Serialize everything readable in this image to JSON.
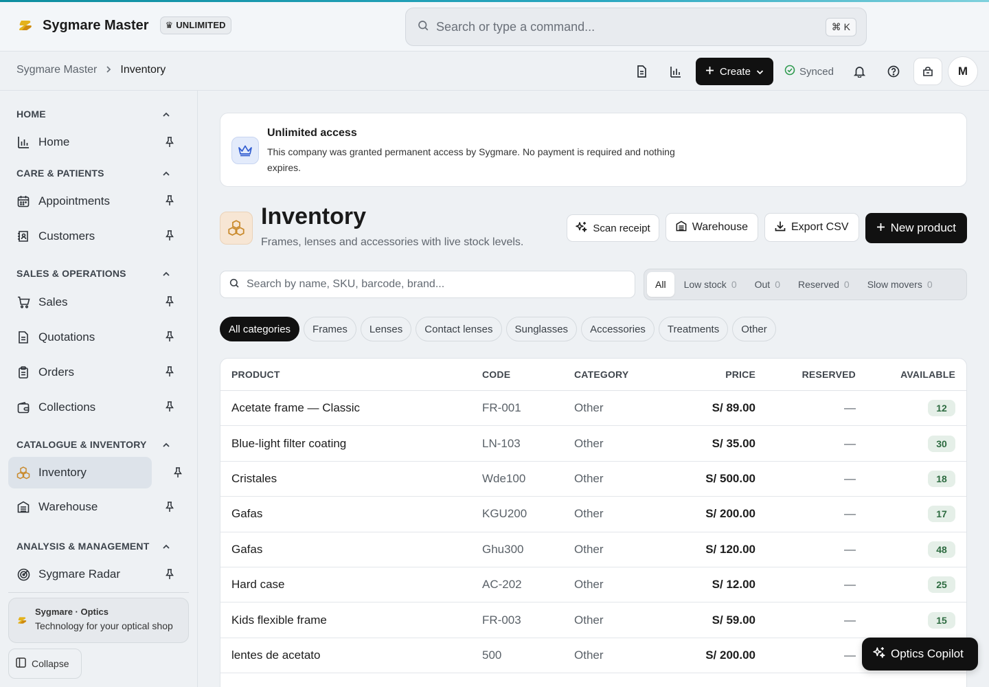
{
  "app": {
    "name": "Sygmare Master",
    "plan_badge": "UNLIMITED",
    "plan_badge_icon": "crown-icon",
    "accent_color": "#0e8ea0"
  },
  "command_search": {
    "placeholder": "Search or type a command...",
    "shortcut": "⌘ K"
  },
  "breadcrumb": {
    "root": "Sygmare Master",
    "current": "Inventory"
  },
  "header_actions": {
    "create_label": "Create",
    "sync_status": "Synced",
    "avatar_initial": "M"
  },
  "sidebar": {
    "sections": [
      {
        "title": "HOME",
        "items": [
          {
            "label": "Home",
            "icon": "bar-chart-icon"
          }
        ]
      },
      {
        "title": "CARE & PATIENTS",
        "items": [
          {
            "label": "Appointments",
            "icon": "calendar-icon"
          },
          {
            "label": "Customers",
            "icon": "contacts-icon"
          }
        ]
      },
      {
        "title": "SALES & OPERATIONS",
        "items": [
          {
            "label": "Sales",
            "icon": "cart-icon"
          },
          {
            "label": "Quotations",
            "icon": "document-icon"
          },
          {
            "label": "Orders",
            "icon": "clipboard-icon"
          },
          {
            "label": "Collections",
            "icon": "wallet-icon"
          }
        ]
      },
      {
        "title": "CATALOGUE & INVENTORY",
        "items": [
          {
            "label": "Inventory",
            "icon": "boxes-icon",
            "active": true
          },
          {
            "label": "Warehouse",
            "icon": "warehouse-icon"
          }
        ]
      },
      {
        "title": "ANALYSIS & MANAGEMENT",
        "items": [
          {
            "label": "Sygmare Radar",
            "icon": "radar-icon"
          }
        ]
      }
    ],
    "promo": {
      "title": "Sygmare · Optics",
      "subtitle": "Technology for your optical shop"
    },
    "collapse_label": "Collapse"
  },
  "notice": {
    "title": "Unlimited access",
    "body": "This company was granted permanent access by Sygmare. No payment is required and nothing expires."
  },
  "page": {
    "title": "Inventory",
    "subtitle": "Frames, lenses and accessories with live stock levels.",
    "actions": {
      "scan_receipt": "Scan receipt",
      "warehouse": "Warehouse",
      "export_csv": "Export CSV",
      "new_product": "New product"
    }
  },
  "inventory_search": {
    "placeholder": "Search by name, SKU, barcode, brand..."
  },
  "stock_filters": [
    {
      "label": "All",
      "count": "",
      "active": true
    },
    {
      "label": "Low stock",
      "count": "0"
    },
    {
      "label": "Out",
      "count": "0"
    },
    {
      "label": "Reserved",
      "count": "0"
    },
    {
      "label": "Slow movers",
      "count": "0"
    }
  ],
  "categories": [
    "All categories",
    "Frames",
    "Lenses",
    "Contact lenses",
    "Sunglasses",
    "Accessories",
    "Treatments",
    "Other"
  ],
  "table": {
    "columns": {
      "product": "PRODUCT",
      "code": "CODE",
      "category": "CATEGORY",
      "price": "PRICE",
      "reserved": "RESERVED",
      "available": "AVAILABLE"
    },
    "rows": [
      {
        "product": "Acetate frame — Classic",
        "code": "FR-001",
        "category": "Other",
        "price": "S/ 89.00",
        "reserved": "—",
        "available": "12"
      },
      {
        "product": "Blue-light filter coating",
        "code": "LN-103",
        "category": "Other",
        "price": "S/ 35.00",
        "reserved": "—",
        "available": "30"
      },
      {
        "product": "Cristales",
        "code": "Wde100",
        "category": "Other",
        "price": "S/ 500.00",
        "reserved": "—",
        "available": "18"
      },
      {
        "product": "Gafas",
        "code": "KGU200",
        "category": "Other",
        "price": "S/ 200.00",
        "reserved": "—",
        "available": "17"
      },
      {
        "product": "Gafas",
        "code": "Ghu300",
        "category": "Other",
        "price": "S/ 120.00",
        "reserved": "—",
        "available": "48"
      },
      {
        "product": "Hard case",
        "code": "AC-202",
        "category": "Other",
        "price": "S/ 12.00",
        "reserved": "—",
        "available": "25"
      },
      {
        "product": "Kids flexible frame",
        "code": "FR-003",
        "category": "Other",
        "price": "S/ 59.00",
        "reserved": "—",
        "available": "15"
      },
      {
        "product": "lentes de acetato",
        "code": "500",
        "category": "Other",
        "price": "S/ 200.00",
        "reserved": "—",
        "available": ""
      }
    ]
  },
  "copilot": {
    "label": "Optics Copilot"
  }
}
